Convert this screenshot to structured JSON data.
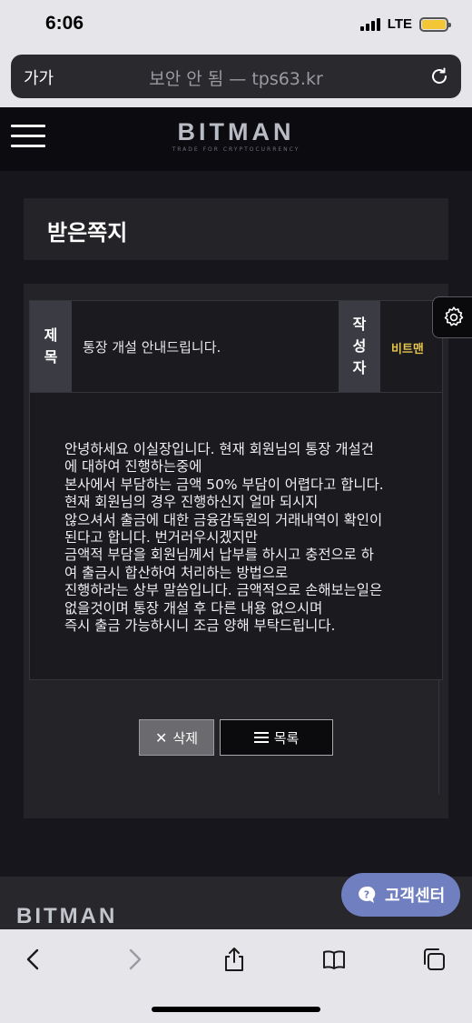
{
  "status_bar": {
    "time": "6:06",
    "network": "LTE"
  },
  "browser": {
    "aa_label": "가가",
    "url_text": "보안 안 됨 — tps63.kr"
  },
  "site": {
    "logo": "BITMAN",
    "logo_tagline": "TRADE FOR CRYPTOCURRENCY",
    "footer_logo": "BITMAN"
  },
  "page": {
    "title": "받은쪽지"
  },
  "message": {
    "subject_label": "제\n목",
    "subject": "통장 개설 안내드립니다.",
    "author_label": "작\n성\n자",
    "author": "비트맨",
    "body_lines": [
      "안녕하세요 이실장입니다. 현재 회원님의 통장 개설건",
      "에 대하여 진행하는중에",
      "본사에서 부담하는 금액 50% 부담이 어렵다고 합니다.",
      "현재 회원님의 경우 진행하신지 얼마 되시지",
      "않으셔서 출금에 대한 금융감독원의 거래내역이 확인이",
      "된다고 합니다. 번거러우시겠지만",
      "금액적 부담을 회원님께서 납부를 하시고 충전으로 하",
      "여 출금시 합산하여 처리하는 방법으로",
      "진행하라는 상부 말씀입니다. 금액적으로 손해보는일은",
      "없을것이며 통장 개설 후 다른 내용 없으시며",
      "즉시 출금 가능하시니 조금 양해 부탁드립니다."
    ]
  },
  "buttons": {
    "delete_label": "삭제",
    "list_label": "목록"
  },
  "support": {
    "label": "고객센터"
  },
  "colors": {
    "accent_gold": "#e6c34d",
    "support_blue": "#6f7fc0"
  }
}
